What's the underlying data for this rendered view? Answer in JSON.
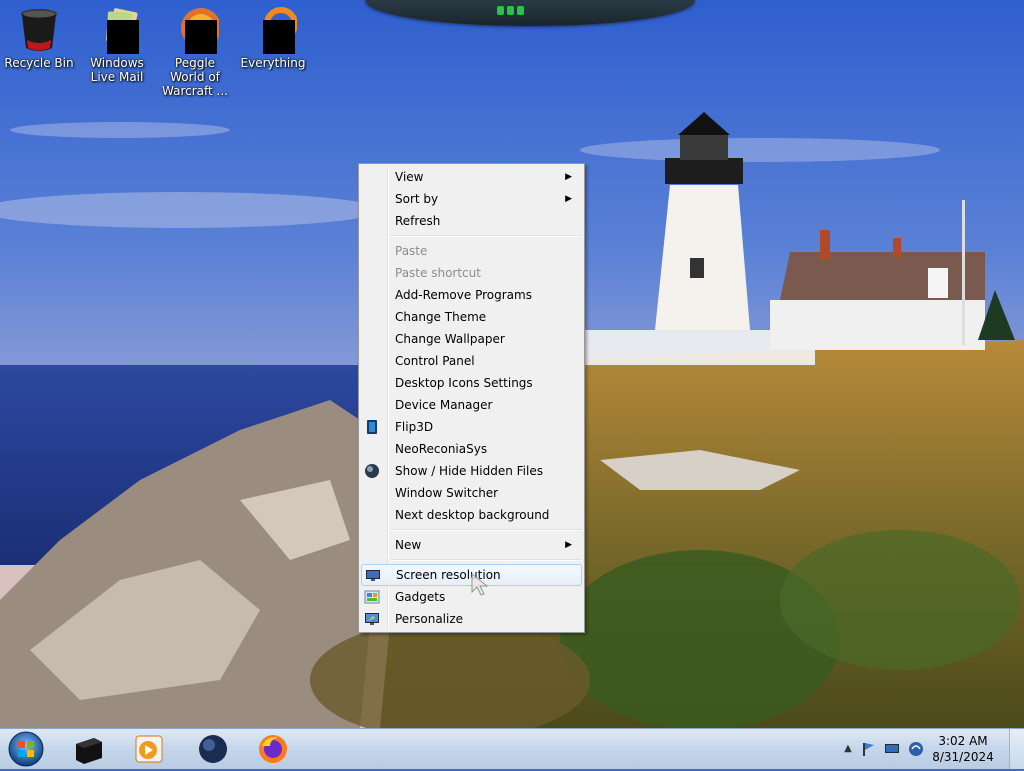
{
  "desktop_icons": [
    {
      "label": "Recycle Bin",
      "icon": "recycle-bin-icon"
    },
    {
      "label": "Windows Live Mail",
      "icon": "windows-live-mail-icon"
    },
    {
      "label": "Peggle World of Warcraft ...",
      "icon": "peggle-icon"
    },
    {
      "label": "Everything",
      "icon": "everything-search-icon"
    }
  ],
  "context_menu": {
    "items": [
      {
        "label": "View",
        "submenu": true
      },
      {
        "label": "Sort by",
        "submenu": true
      },
      {
        "label": "Refresh"
      },
      {
        "label": "Paste",
        "disabled": true
      },
      {
        "label": "Paste shortcut",
        "disabled": true
      },
      {
        "label": "Add-Remove Programs"
      },
      {
        "label": "Change Theme"
      },
      {
        "label": "Change Wallpaper"
      },
      {
        "label": "Control Panel"
      },
      {
        "label": "Desktop Icons Settings"
      },
      {
        "label": "Device Manager"
      },
      {
        "label": "Flip3D",
        "icon": "flip3d-icon"
      },
      {
        "label": "NeoReconiaSys"
      },
      {
        "label": "Show / Hide Hidden Files",
        "icon": "globe-icon"
      },
      {
        "label": "Window Switcher"
      },
      {
        "label": "Next desktop background"
      },
      {
        "label": "New",
        "submenu": true
      },
      {
        "label": "Screen resolution",
        "icon": "monitor-icon",
        "highlighted": true
      },
      {
        "label": "Gadgets",
        "icon": "gadgets-icon"
      },
      {
        "label": "Personalize",
        "icon": "personalize-icon"
      }
    ]
  },
  "taskbar": {
    "start_icon": "windows-logo-icon",
    "apps": [
      {
        "icon": "black-box-app-icon"
      },
      {
        "icon": "media-player-icon"
      },
      {
        "icon": "globe-app-icon"
      },
      {
        "icon": "firefox-icon"
      }
    ],
    "tray": {
      "icons": [
        "show-hidden-icons-chevron",
        "notification-flag-icon",
        "display-icon",
        "network-icon"
      ],
      "time": "3:02 AM",
      "date": "8/31/2024"
    }
  },
  "colors": {
    "menu_bg": "#f0f0f0",
    "highlight_border": "#aecff7",
    "taskbar_bg": "#c5d6ea"
  }
}
